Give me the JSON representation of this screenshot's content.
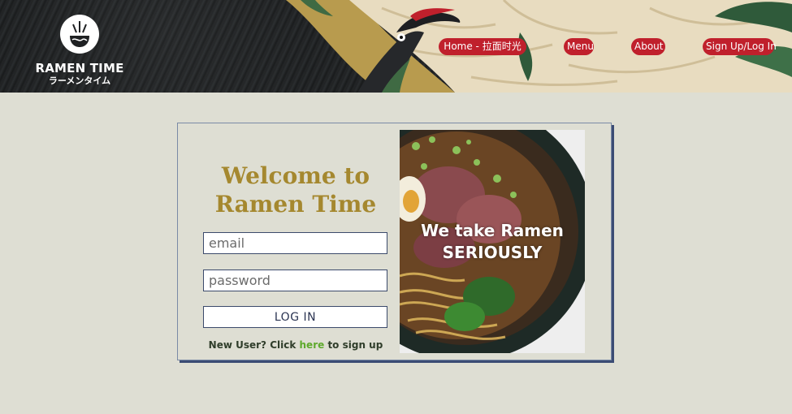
{
  "brand": {
    "name": "RAMEN TIME",
    "subtitle": "ラーメンタイム",
    "logo_icon": "ramen-bowl-logo-icon"
  },
  "nav": {
    "home": "Home - 拉面时光",
    "menu": "Menu",
    "about": "About",
    "signup": "Sign Up/Log In"
  },
  "login": {
    "welcome_line1": "Welcome to",
    "welcome_line2": "Ramen Time",
    "email_placeholder": "email",
    "password_placeholder": "password",
    "login_button": "LOG IN",
    "new_user_prefix": "New User? Click ",
    "new_user_link": "here",
    "new_user_suffix": " to sign up"
  },
  "hero": {
    "line1": "We take Ramen",
    "line2": "SERIOUSLY"
  },
  "colors": {
    "page_background": "#deded3",
    "nav_button": "#c0202c",
    "welcome_text": "#a5882f",
    "link": "#5ea92c",
    "card_shadow": "#3b4c74"
  }
}
